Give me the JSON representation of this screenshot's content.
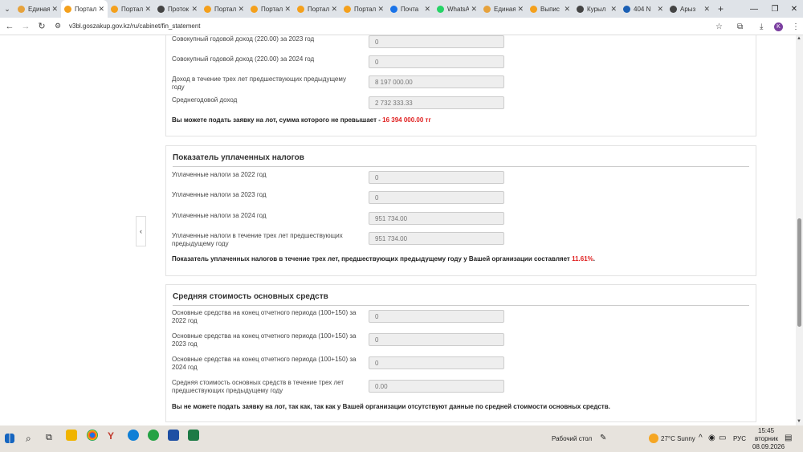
{
  "browser": {
    "tabs": [
      {
        "label": "Единая",
        "color": "#e6a23c",
        "active": false
      },
      {
        "label": "Портал",
        "color": "#f4a01c",
        "active": true
      },
      {
        "label": "Портал",
        "color": "#f4a01c",
        "active": false
      },
      {
        "label": "Проток",
        "color": "#444444",
        "active": false
      },
      {
        "label": "Портал",
        "color": "#f4a01c",
        "active": false
      },
      {
        "label": "Портал",
        "color": "#f4a01c",
        "active": false
      },
      {
        "label": "Портал",
        "color": "#f4a01c",
        "active": false
      },
      {
        "label": "Портал",
        "color": "#f4a01c",
        "active": false
      },
      {
        "label": "Почта",
        "color": "#1a73e8",
        "active": false
      },
      {
        "label": "WhatsA",
        "color": "#25d366",
        "active": false
      },
      {
        "label": "Единая",
        "color": "#e6a23c",
        "active": false
      },
      {
        "label": "Выпис",
        "color": "#f4a01c",
        "active": false
      },
      {
        "label": "Курыл",
        "color": "#444444",
        "active": false
      },
      {
        "label": "404 N",
        "color": "#1a5fb4",
        "active": false
      },
      {
        "label": "Арыз",
        "color": "#444444",
        "active": false
      }
    ],
    "url": "v3bl.goszakup.gov.kz/ru/cabinet/fin_statement",
    "avatar_letter": "K"
  },
  "income_section": {
    "rows": [
      {
        "label": "Совокупный годовой доход (220.00) за 2023 год",
        "value": "0"
      },
      {
        "label": "Совокупный годовой доход (220.00) за 2024 год",
        "value": "0"
      },
      {
        "label": "Доход в течение трех лет предшествующих предыдущему году",
        "value": "8 197 000.00"
      },
      {
        "label": "Среднегодовой доход",
        "value": "2 732 333.33"
      }
    ],
    "note_prefix": "Вы можете подать заявку на лот, сумма которого не превышает -",
    "note_amount": "16 394 000.00 тг"
  },
  "taxes_section": {
    "title": "Показатель уплаченных налогов",
    "rows": [
      {
        "label": "Уплаченные налоги за 2022 год",
        "value": "0"
      },
      {
        "label": "Уплаченные налоги за 2023 год",
        "value": "0"
      },
      {
        "label": "Уплаченные налоги за 2024 год",
        "value": "951 734.00"
      },
      {
        "label": "Уплаченные налоги в течение трех лет предшествующих предыдущему году",
        "value": "951 734.00"
      }
    ],
    "note_prefix": "Показатель уплаченных налогов в течение трех лет, предшествующих предыдущему году у Вашей организации составляет",
    "note_percent": "11.61%",
    "note_suffix": "."
  },
  "assets_section": {
    "title": "Средняя стоимость основных средств",
    "rows": [
      {
        "label": "Основные средства на конец отчетного периода (100+150) за 2022 год",
        "value": "0"
      },
      {
        "label": "Основные средства на конец отчетного периода (100+150) за 2023 год",
        "value": "0"
      },
      {
        "label": "Основные средства на конец отчетного периода (100+150) за 2024 год",
        "value": "0"
      },
      {
        "label": "Средняя стоимость основных средств в течение трех лет предшествующих предыдущему году",
        "value": "0.00"
      }
    ],
    "note": "Вы не можете подать заявку на лот, так как, так как у Вашей организации отсутствуют данные по средней стоимости основных средств."
  },
  "taskbar": {
    "desktop_label": "Рабочий стол",
    "weather": "27°C Sunny",
    "lang": "РУС",
    "time": "15:45",
    "weekday": "вторник",
    "date": "08.09.2026"
  }
}
